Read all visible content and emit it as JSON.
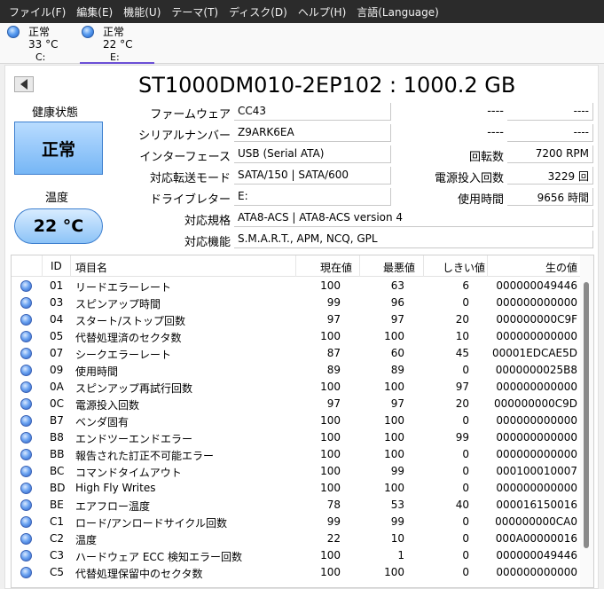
{
  "menu": [
    "ファイル(F)",
    "編集(E)",
    "機能(U)",
    "テーマ(T)",
    "ディスク(D)",
    "ヘルプ(H)",
    "言語(Language)"
  ],
  "drives": [
    {
      "status": "正常",
      "temp": "33 °C",
      "letter": "C:"
    },
    {
      "status": "正常",
      "temp": "22 °C",
      "letter": "E:"
    }
  ],
  "title": "ST1000DM010-2EP102 : 1000.2 GB",
  "health": {
    "label": "健康状態",
    "value": "正常"
  },
  "temperature": {
    "label": "温度",
    "value": "22 °C"
  },
  "info": {
    "firmware": {
      "label": "ファームウェア",
      "value": "CC43"
    },
    "serial": {
      "label": "シリアルナンバー",
      "value": "Z9ARK6EA"
    },
    "interface": {
      "label": "インターフェース",
      "value": "USB (Serial ATA)"
    },
    "transfer": {
      "label": "対応転送モード",
      "value": "SATA/150 | SATA/600"
    },
    "drive_letter": {
      "label": "ドライブレター",
      "value": "E:"
    },
    "standard": {
      "label": "対応規格",
      "value": "ATA8-ACS | ATA8-ACS version 4"
    },
    "features": {
      "label": "対応機能",
      "value": "S.M.A.R.T., APM, NCQ, GPL"
    },
    "right1": {
      "label": "----",
      "value": "----"
    },
    "right2": {
      "label": "----",
      "value": "----"
    },
    "rotation": {
      "label": "回転数",
      "value": "7200 RPM"
    },
    "power_count": {
      "label": "電源投入回数",
      "value": "3229 回"
    },
    "hours": {
      "label": "使用時間",
      "value": "9656 時間"
    }
  },
  "table": {
    "headers": [
      "ID",
      "項目名",
      "現在値",
      "最悪値",
      "しきい値",
      "生の値"
    ],
    "rows": [
      [
        "01",
        "リードエラーレート",
        "100",
        "63",
        "6",
        "000000049446"
      ],
      [
        "03",
        "スピンアップ時間",
        "99",
        "96",
        "0",
        "000000000000"
      ],
      [
        "04",
        "スタート/ストップ回数",
        "97",
        "97",
        "20",
        "000000000C9F"
      ],
      [
        "05",
        "代替処理済のセクタ数",
        "100",
        "100",
        "10",
        "000000000000"
      ],
      [
        "07",
        "シークエラーレート",
        "87",
        "60",
        "45",
        "00001EDCAE5D"
      ],
      [
        "09",
        "使用時間",
        "89",
        "89",
        "0",
        "0000000025B8"
      ],
      [
        "0A",
        "スピンアップ再試行回数",
        "100",
        "100",
        "97",
        "000000000000"
      ],
      [
        "0C",
        "電源投入回数",
        "97",
        "97",
        "20",
        "000000000C9D"
      ],
      [
        "B7",
        "ベンダ固有",
        "100",
        "100",
        "0",
        "000000000000"
      ],
      [
        "B8",
        "エンドツーエンドエラー",
        "100",
        "100",
        "99",
        "000000000000"
      ],
      [
        "BB",
        "報告された訂正不可能エラー",
        "100",
        "100",
        "0",
        "000000000000"
      ],
      [
        "BC",
        "コマンドタイムアウト",
        "100",
        "99",
        "0",
        "000100010007"
      ],
      [
        "BD",
        "High Fly Writes",
        "100",
        "100",
        "0",
        "000000000000"
      ],
      [
        "BE",
        "エアフロー温度",
        "78",
        "53",
        "40",
        "000016150016"
      ],
      [
        "C1",
        "ロード/アンロードサイクル回数",
        "99",
        "99",
        "0",
        "000000000CA0"
      ],
      [
        "C2",
        "温度",
        "22",
        "10",
        "0",
        "000A00000016"
      ],
      [
        "C3",
        "ハードウェア ECC 検知エラー回数",
        "100",
        "1",
        "0",
        "000000049446"
      ],
      [
        "C5",
        "代替処理保留中のセクタ数",
        "100",
        "100",
        "0",
        "000000000000"
      ]
    ]
  }
}
